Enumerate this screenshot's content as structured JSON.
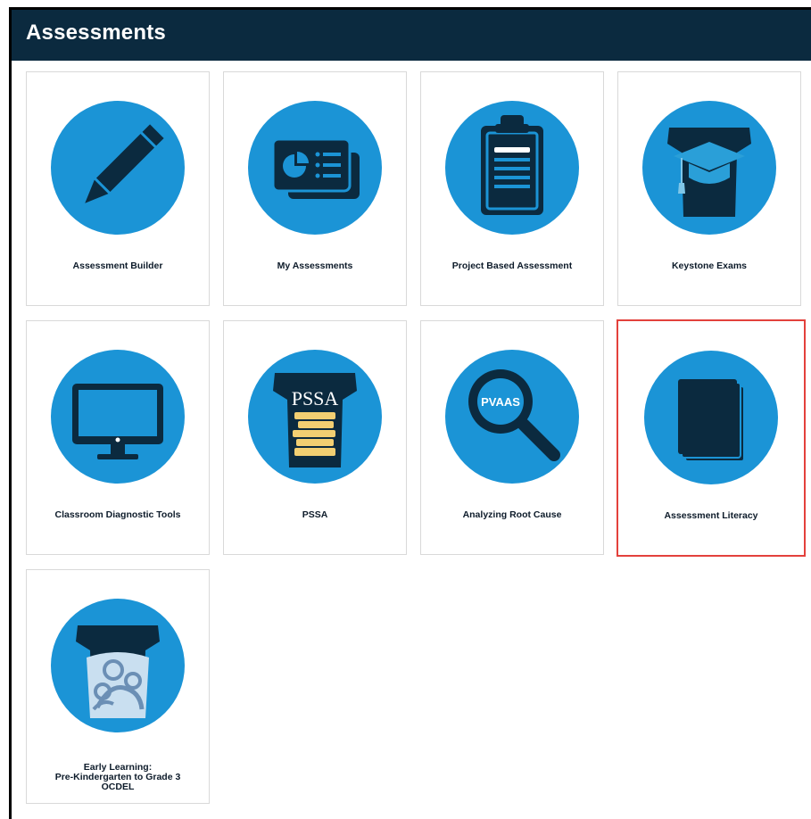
{
  "header": {
    "title": "Assessments"
  },
  "tiles": [
    {
      "label": "Assessment Builder",
      "icon": "pencil-icon"
    },
    {
      "label": "My Assessments",
      "icon": "presentation-cards-icon"
    },
    {
      "label": "Project Based Assessment",
      "icon": "clipboard-icon"
    },
    {
      "label": "Keystone Exams",
      "icon": "keystone-graduation-cap-icon"
    },
    {
      "label": "Classroom Diagnostic Tools",
      "icon": "monitor-icon"
    },
    {
      "label": "PSSA",
      "icon": "pssa-keystone-books-icon",
      "icon_text": "PSSA"
    },
    {
      "label": "Analyzing Root Cause",
      "icon": "pvaas-magnifier-icon",
      "icon_text": "PVAAS"
    },
    {
      "label": "Assessment Literacy",
      "icon": "books-stack-icon"
    },
    {
      "label_lines": [
        "Early Learning:",
        "Pre-Kindergarten to Grade 3",
        "OCDEL"
      ],
      "icon": "ocdel-keystone-family-icon"
    }
  ],
  "colors": {
    "header_bg": "#0b2a3f",
    "circle": "#1b94d6",
    "icon_dark": "#0b2a3f",
    "highlight": "#e3413c",
    "book_yellow": "#f2cf72"
  }
}
